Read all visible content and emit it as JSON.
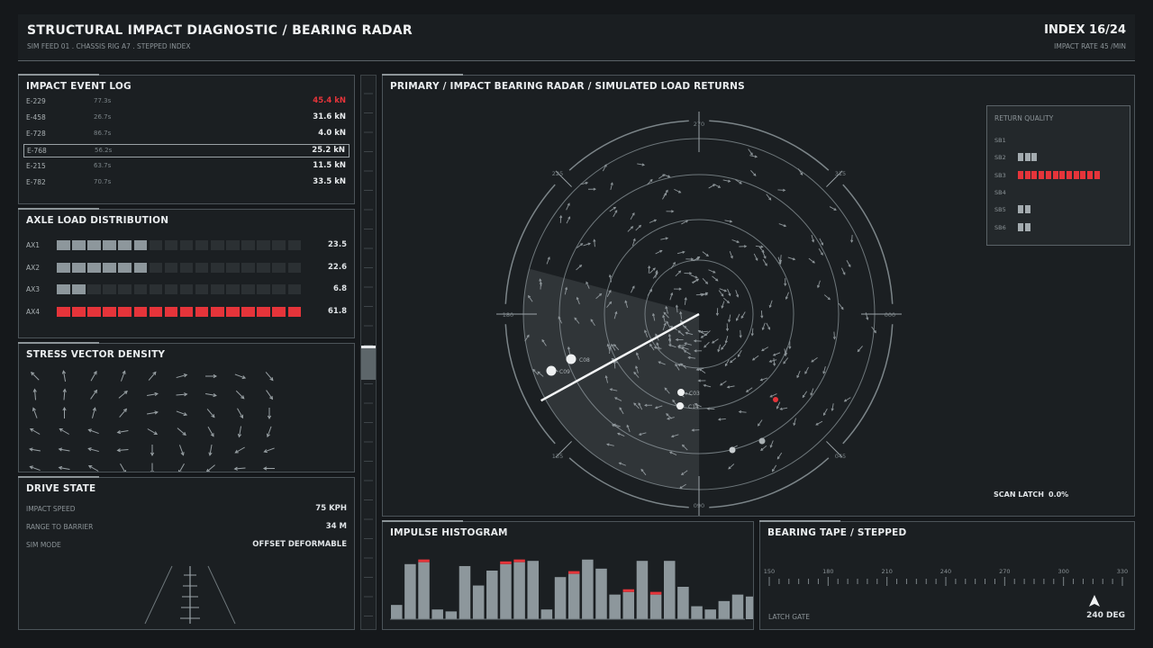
{
  "header": {
    "title": "STRUCTURAL IMPACT DIAGNOSTIC / BEARING RADAR",
    "subtitle": "SIM FEED 01 . CHASSIS RIG A7 . STEPPED INDEX",
    "index": "INDEX 16/24",
    "impact_rate": "IMPACT RATE 45 /MIN"
  },
  "event_log": {
    "title": "IMPACT EVENT LOG",
    "rows": [
      {
        "id": "E-229",
        "time": "77.3s",
        "value": "45.4 kN",
        "alert": true,
        "selected": false
      },
      {
        "id": "E-458",
        "time": "26.7s",
        "value": "31.6 kN",
        "alert": false,
        "selected": false
      },
      {
        "id": "E-728",
        "time": "86.7s",
        "value": "4.0 kN",
        "alert": false,
        "selected": false
      },
      {
        "id": "E-768",
        "time": "56.2s",
        "value": "25.2 kN",
        "alert": false,
        "selected": true
      },
      {
        "id": "E-215",
        "time": "63.7s",
        "value": "11.5 kN",
        "alert": false,
        "selected": false
      },
      {
        "id": "E-782",
        "time": "70.7s",
        "value": "33.5 kN",
        "alert": false,
        "selected": false
      }
    ]
  },
  "axle": {
    "title": "AXLE LOAD DISTRIBUTION",
    "segments_total": 16,
    "rows": [
      {
        "label": "AX1",
        "filled": 6,
        "value": "23.5",
        "alert": false
      },
      {
        "label": "AX2",
        "filled": 6,
        "value": "22.6",
        "alert": false
      },
      {
        "label": "AX3",
        "filled": 2,
        "value": "6.8",
        "alert": false
      },
      {
        "label": "AX4",
        "filled": 16,
        "value": "61.8",
        "alert": true
      }
    ]
  },
  "stress": {
    "title": "STRESS VECTOR DENSITY",
    "angles": [
      [
        -135,
        -100,
        -60,
        -70,
        -50,
        -15,
        0,
        20,
        50
      ],
      [
        -95,
        -85,
        -55,
        -40,
        -10,
        -5,
        10,
        45,
        55
      ],
      [
        -110,
        -90,
        -75,
        -50,
        -10,
        20,
        50,
        60,
        90
      ],
      [
        -150,
        -150,
        -160,
        170,
        30,
        40,
        60,
        100,
        110
      ],
      [
        -170,
        -170,
        -165,
        175,
        90,
        70,
        100,
        150,
        160
      ],
      [
        -160,
        -170,
        -150,
        60,
        90,
        120,
        140,
        175,
        180
      ]
    ]
  },
  "drive": {
    "title": "DRIVE STATE",
    "rows": [
      {
        "label": "IMPACT SPEED",
        "value": "75 KPH"
      },
      {
        "label": "RANGE TO BARRIER",
        "value": "34 M"
      },
      {
        "label": "SIM MODE",
        "value": "OFFSET DEFORMABLE"
      }
    ]
  },
  "scrollbar": {
    "position": 0.52
  },
  "radar": {
    "title": "PRIMARY / IMPACT BEARING RADAR / SIMULATED LOAD RETURNS",
    "bearing_labels": [
      "270",
      "315",
      "000",
      "045",
      "090",
      "135",
      "180",
      "225"
    ],
    "sweep_deg": 240,
    "contacts": [
      {
        "label": "C08",
        "big": true
      },
      {
        "label": "C09",
        "big": true
      },
      {
        "label": "C03",
        "big": false
      },
      {
        "label": "C14",
        "big": false
      }
    ],
    "scan_latch_label": "SCAN LATCH",
    "scan_latch_value": "0.0%",
    "quality": {
      "title": "RETURN QUALITY",
      "rows": [
        {
          "label": "SB1",
          "bars": 0,
          "alert": false
        },
        {
          "label": "SB2",
          "bars": 3,
          "alert": false
        },
        {
          "label": "SB3",
          "bars": 12,
          "alert": true
        },
        {
          "label": "SB4",
          "bars": 0,
          "alert": false
        },
        {
          "label": "SB5",
          "bars": 2,
          "alert": false
        },
        {
          "label": "SB6",
          "bars": 2,
          "alert": false
        }
      ]
    }
  },
  "histogram": {
    "title": "IMPULSE HISTOGRAM",
    "values": [
      22,
      85,
      88,
      15,
      12,
      82,
      52,
      75,
      85,
      88,
      90,
      15,
      65,
      70,
      92,
      78,
      38,
      42,
      90,
      38,
      90,
      50,
      20,
      15,
      28,
      38,
      35
    ],
    "alerts": [
      2,
      8,
      9,
      13,
      17,
      19
    ]
  },
  "tape": {
    "title": "BEARING TAPE / STEPPED",
    "labels": [
      "150",
      "180",
      "210",
      "240",
      "270",
      "300",
      "330"
    ],
    "latch_label": "LATCH GATE",
    "value": "240 DEG"
  },
  "colors": {
    "accent": "#e5343a",
    "bar": "#8d979c",
    "bar_dim": "#2b3033",
    "text": "#dfe3e6"
  }
}
